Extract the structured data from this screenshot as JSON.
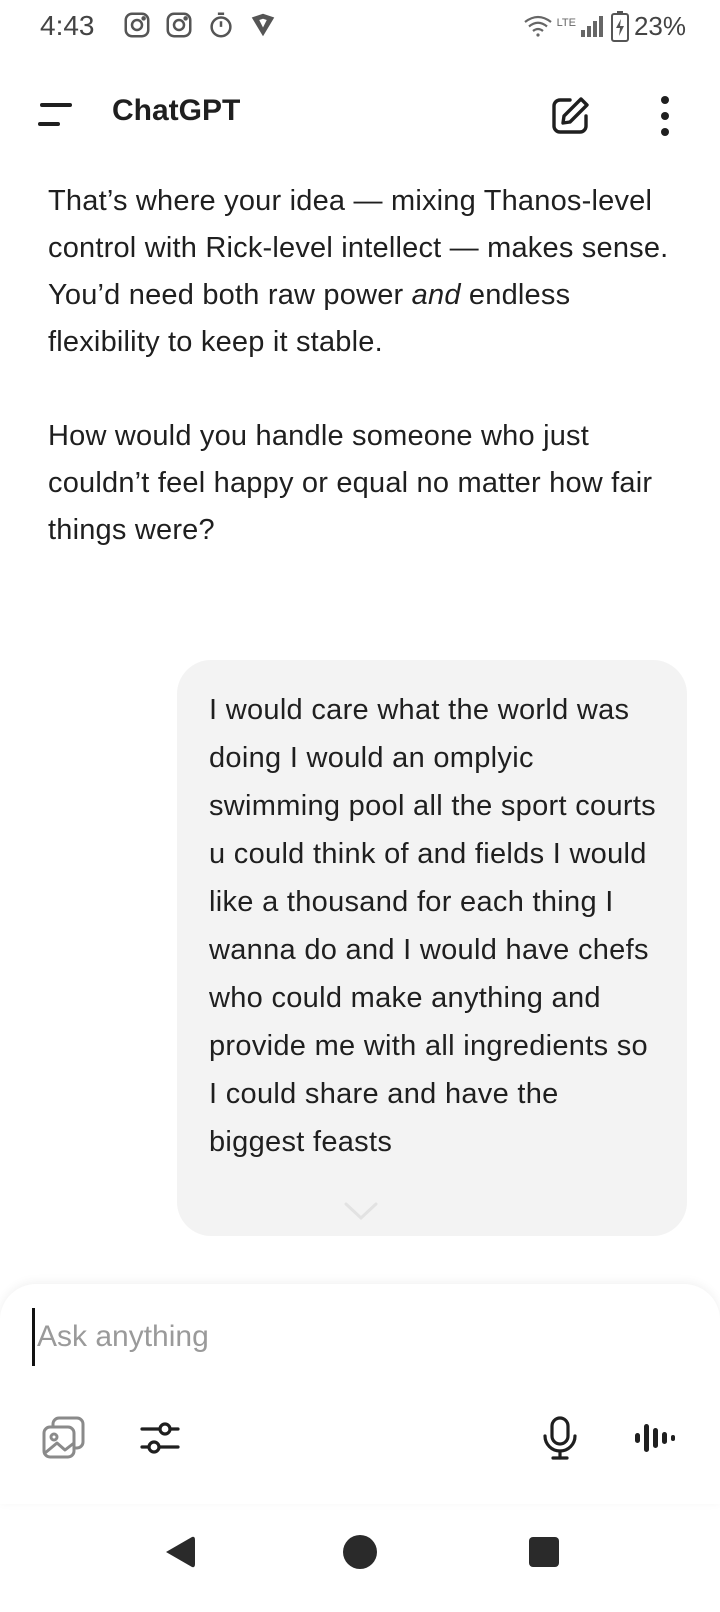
{
  "status_bar": {
    "time": "4:43",
    "network": "LTE",
    "battery": "23%",
    "left_icons": [
      "instagram-icon",
      "instagram-icon",
      "timer-icon",
      "vpn-shield-icon"
    ]
  },
  "header": {
    "title": "ChatGPT",
    "menu_icon": "menu-icon",
    "new_chat_icon": "edit-icon",
    "more_icon": "more-vertical-icon"
  },
  "messages": {
    "assistant": {
      "p1_part1": "That’s where your idea — mixing Thanos-level control with Rick-level intellect — makes sense. You’d need both raw power ",
      "p1_emph": "and",
      "p1_part2": " endless flexibility to keep it stable.",
      "p2": "How would you handle someone who just couldn’t feel happy or equal no matter how fair things were?"
    },
    "user": {
      "text": "I would care what the world was doing I would an omplyic swimming pool all the sport courts u could think of and fields I would like a thousand for each thing I wanna do and I would have chefs who could make anything and provide me with all ingredients so I could share and have the biggest feasts"
    }
  },
  "composer": {
    "placeholder": "Ask anything",
    "value": "",
    "buttons": [
      "photos-icon",
      "tools-icon",
      "microphone-icon",
      "voice-mode-icon"
    ]
  },
  "nav_bar": {
    "buttons": [
      "back-icon",
      "home-icon",
      "recents-icon"
    ]
  },
  "colors": {
    "background": "#ffffff",
    "text": "#1f1f1f",
    "user_bubble": "#f3f3f3",
    "placeholder": "#9a9a9a"
  }
}
